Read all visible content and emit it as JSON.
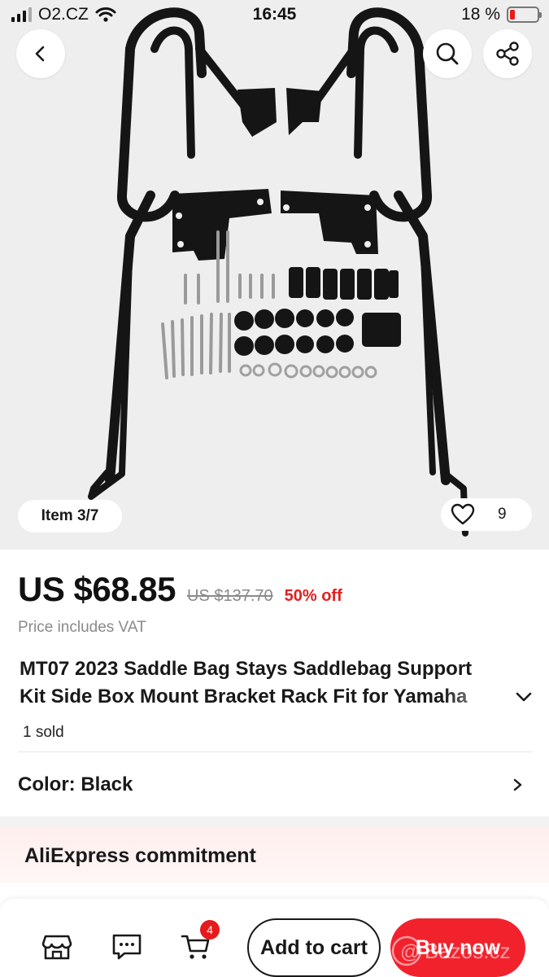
{
  "status_bar": {
    "carrier": "O2.CZ",
    "time": "16:45",
    "battery": "18 %",
    "battery_level": 0.18
  },
  "gallery": {
    "item_indicator": "Item 3/7",
    "wishlist_count": "9"
  },
  "product": {
    "price": "US $68.85",
    "original_price": "US $137.70",
    "discount": "50% off",
    "vat_note": "Price includes VAT",
    "title_line1": "MT07 2023 Saddle Bag Stays Saddlebag Support",
    "title_line2": "Kit Side Box Mount Bracket Rack Fit for Yamaha",
    "sold": "1 sold",
    "color_label": "Color: Black"
  },
  "commitment": {
    "label": "AliExpress commitment"
  },
  "bottom_bar": {
    "cart_count": "4",
    "add_to_cart": "Add to cart",
    "buy_now": "Buy now"
  },
  "watermark": {
    "text": "Bazos.cz"
  },
  "colors": {
    "accent_red": "#f2222d",
    "discount_red": "#e02020",
    "badge_red": "#e51b1b",
    "commitment_bg": "#fdeeed",
    "hero_bg": "#eeeeee"
  },
  "icons": [
    "back-icon",
    "search-icon",
    "share-icon",
    "heart-icon",
    "chevron-down-icon",
    "chevron-right-icon",
    "store-icon",
    "chat-icon",
    "cart-icon",
    "wifi-icon",
    "signal-icon",
    "battery-icon"
  ]
}
